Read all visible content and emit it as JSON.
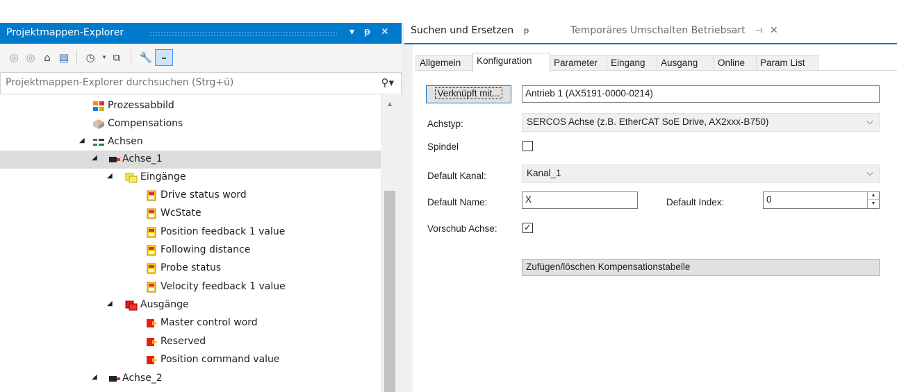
{
  "solution_explorer": {
    "title": "Projektmappen-Explorer",
    "search_placeholder": "Projektmappen-Explorer durchsuchen (Strg+ü)",
    "tree": [
      {
        "label": "Prozessabbild"
      },
      {
        "label": "Compensations"
      },
      {
        "label": "Achsen"
      },
      {
        "label": "Achse_1"
      },
      {
        "label": "Eingänge"
      },
      {
        "label": "Drive status word"
      },
      {
        "label": "WcState"
      },
      {
        "label": "Position feedback 1 value"
      },
      {
        "label": "Following distance"
      },
      {
        "label": "Probe status"
      },
      {
        "label": "Velocity feedback 1 value"
      },
      {
        "label": "Ausgänge"
      },
      {
        "label": "Master control word"
      },
      {
        "label": "Reserved"
      },
      {
        "label": "Position command value"
      },
      {
        "label": "Achse_2"
      }
    ]
  },
  "doc_tabs": [
    {
      "label": "Suchen und Ersetzen"
    },
    {
      "label": "Temporäres Umschalten Betriebsart"
    }
  ],
  "property_tabs": [
    {
      "label": "Allgemein"
    },
    {
      "label": "Konfiguration"
    },
    {
      "label": "Parameter"
    },
    {
      "label": "Eingang"
    },
    {
      "label": "Ausgang"
    },
    {
      "label": "Online"
    },
    {
      "label": "Param List"
    }
  ],
  "config": {
    "linked_button": "Verknüpft mit...",
    "linked_value": "Antrieb 1 (AX5191-0000-0214)",
    "axis_type_label": "Achstyp:",
    "axis_type_value": "SERCOS Achse (z.B. EtherCAT SoE Drive, AX2xxx-B750)",
    "spindle_label": "Spindel",
    "spindle_checked": false,
    "default_channel_label": "Default Kanal:",
    "default_channel_value": "Kanal_1",
    "default_name_label": "Default Name:",
    "default_name_value": "X",
    "default_index_label": "Default Index:",
    "default_index_value": "0",
    "feed_axis_label": "Vorschub Achse:",
    "feed_axis_checked": true,
    "compensation_button": "Zufügen/löschen Kompensationstabelle"
  },
  "colors": {
    "titlebar": "#007acc",
    "selection": "#dcdcdc",
    "doc_accent": "#1b6fbb"
  }
}
